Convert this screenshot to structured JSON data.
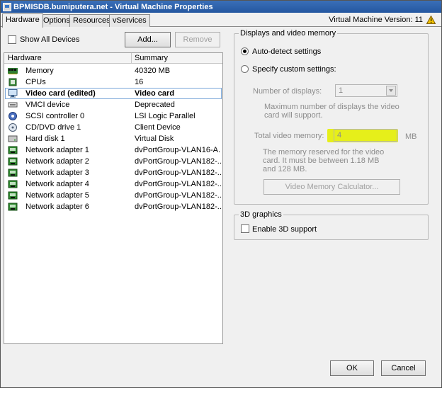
{
  "window": {
    "title": "BPMISDB.bumiputera.net - Virtual Machine Properties",
    "vm_version": "Virtual Machine Version: 11"
  },
  "tabs": [
    {
      "label": "Hardware",
      "active": true
    },
    {
      "label": "Options",
      "active": false
    },
    {
      "label": "Resources",
      "active": false
    },
    {
      "label": "vServices",
      "active": false
    }
  ],
  "left": {
    "show_all_devices": "Show All Devices",
    "add_label": "Add...",
    "remove_label": "Remove",
    "columns": {
      "hardware": "Hardware",
      "summary": "Summary"
    },
    "rows": [
      {
        "name": "Memory",
        "summary": "40320 MB",
        "icon": "memory-icon"
      },
      {
        "name": "CPUs",
        "summary": "16",
        "icon": "cpu-icon"
      },
      {
        "name": "Video card  (edited)",
        "summary": "Video card",
        "icon": "monitor-icon",
        "selected": true
      },
      {
        "name": "VMCI device",
        "summary": "Deprecated",
        "icon": "vmci-icon"
      },
      {
        "name": "SCSI controller 0",
        "summary": "LSI Logic Parallel",
        "icon": "scsi-icon"
      },
      {
        "name": "CD/DVD drive 1",
        "summary": "Client Device",
        "icon": "cd-icon"
      },
      {
        "name": "Hard disk 1",
        "summary": "Virtual Disk",
        "icon": "disk-icon"
      },
      {
        "name": "Network adapter 1",
        "summary": "dvPortGroup-VLAN16-A...",
        "icon": "network-icon"
      },
      {
        "name": "Network adapter 2",
        "summary": "dvPortGroup-VLAN182-...",
        "icon": "network-icon"
      },
      {
        "name": "Network adapter 3",
        "summary": "dvPortGroup-VLAN182-...",
        "icon": "network-icon"
      },
      {
        "name": "Network adapter 4",
        "summary": "dvPortGroup-VLAN182-...",
        "icon": "network-icon"
      },
      {
        "name": "Network adapter 5",
        "summary": "dvPortGroup-VLAN182-...",
        "icon": "network-icon"
      },
      {
        "name": "Network adapter 6",
        "summary": "dvPortGroup-VLAN182-...",
        "icon": "network-icon"
      }
    ]
  },
  "display": {
    "group_title": "Displays and video memory",
    "auto_detect": "Auto-detect settings",
    "custom": "Specify custom settings:",
    "num_displays_label": "Number of displays:",
    "num_displays_value": "1",
    "max_displays_note": "Maximum number of displays the video card will support.",
    "total_vram_label": "Total video memory:",
    "total_vram_value": "4",
    "vram_unit": "MB",
    "vram_note": "The memory reserved for the video card. It must be between 1.18 MB and 128 MB.",
    "calc_label": "Video Memory Calculator..."
  },
  "graphics3d": {
    "group_title": "3D graphics",
    "enable_label": "Enable 3D support"
  },
  "footer": {
    "ok_label": "OK",
    "cancel_label": "Cancel"
  },
  "colors": {
    "highlight": "#e6ef1a",
    "title_bar": "#2f64ac"
  }
}
